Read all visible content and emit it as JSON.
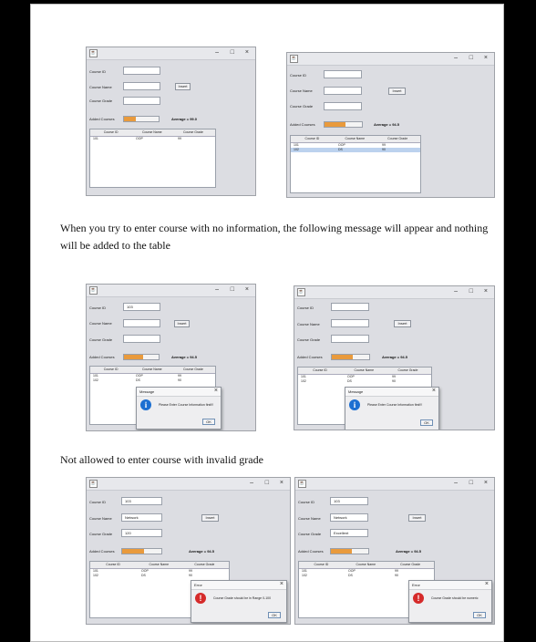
{
  "paragraphs": {
    "p1_line1": "When you try to enter course with no information, the following message will appear and nothing",
    "p1_line2": "will be added to the table",
    "p2": "Not allowed to enter course with invalid grade"
  },
  "screens": [
    {
      "labels": {
        "course_id": "Course ID",
        "course_name": "Course Name",
        "course_grade": "Course Grade",
        "added_courses": "Added Courses"
      },
      "values": {
        "course_id": "",
        "course_name": "",
        "course_grade": ""
      },
      "insert_label": "Insert",
      "progress": 0.35,
      "average": "Average = 99.0",
      "columns": [
        "Course ID",
        "Course Name",
        "Course Grade"
      ],
      "rows": [
        [
          "101",
          "OOP",
          "99"
        ]
      ]
    },
    {
      "labels": {
        "course_id": "Course ID",
        "course_name": "Course Name",
        "course_grade": "Course Grade",
        "added_courses": "Added Courses"
      },
      "values": {
        "course_id": "",
        "course_name": "",
        "course_grade": ""
      },
      "insert_label": "Insert",
      "progress": 0.55,
      "average": "Average = 94.5",
      "columns": [
        "Course ID",
        "Course Name",
        "Course Grade"
      ],
      "rows": [
        [
          "101",
          "OOP",
          "99"
        ],
        [
          "102",
          "DS",
          "90"
        ]
      ]
    },
    {
      "labels": {
        "course_id": "Course ID",
        "course_name": "Course Name",
        "course_grade": "Course Grade",
        "added_courses": "Added Courses"
      },
      "values": {
        "course_id": "103",
        "course_name": "",
        "course_grade": ""
      },
      "insert_label": "Insert",
      "progress": 0.55,
      "average": "Average = 94.5",
      "columns": [
        "Course ID",
        "Course Name",
        "Course Grade"
      ],
      "rows": [
        [
          "101",
          "OOP",
          "99"
        ],
        [
          "102",
          "DS",
          "90"
        ]
      ],
      "dialog": {
        "title": "Message",
        "message": "Please Enter Course Information first!!!",
        "ok": "OK",
        "icon": "info"
      }
    },
    {
      "labels": {
        "course_id": "Course ID",
        "course_name": "Course Name",
        "course_grade": "Course Grade",
        "added_courses": "Added Courses"
      },
      "values": {
        "course_id": "",
        "course_name": "",
        "course_grade": ""
      },
      "insert_label": "Insert",
      "progress": 0.55,
      "average": "Average = 94.5",
      "columns": [
        "Course ID",
        "Course Name",
        "Course Grade"
      ],
      "rows": [
        [
          "101",
          "OOP",
          "99"
        ],
        [
          "102",
          "DS",
          "90"
        ]
      ],
      "dialog": {
        "title": "Message",
        "message": "Please Enter Course Information first!!!",
        "ok": "OK",
        "icon": "info"
      }
    },
    {
      "labels": {
        "course_id": "Course ID",
        "course_name": "Course Name",
        "course_grade": "Course Grade",
        "added_courses": "Added Courses"
      },
      "values": {
        "course_id": "103",
        "course_name": "Network",
        "course_grade": "120"
      },
      "insert_label": "Insert",
      "progress": 0.55,
      "average": "Average = 94.5",
      "columns": [
        "Course ID",
        "Course Name",
        "Course Grade"
      ],
      "rows": [
        [
          "101",
          "OOP",
          "99"
        ],
        [
          "102",
          "DS",
          "90"
        ]
      ],
      "dialog": {
        "title": "Error",
        "message": "Course Grade should be in Range 0-100",
        "ok": "OK",
        "icon": "error"
      }
    },
    {
      "labels": {
        "course_id": "Course ID",
        "course_name": "Course Name",
        "course_grade": "Course Grade",
        "added_courses": "Added Courses"
      },
      "values": {
        "course_id": "103",
        "course_name": "Network",
        "course_grade": "Excellent"
      },
      "insert_label": "Insert",
      "progress": 0.55,
      "average": "Average = 94.5",
      "columns": [
        "Course ID",
        "Course Name",
        "Course Grade"
      ],
      "rows": [
        [
          "101",
          "OOP",
          "99"
        ],
        [
          "102",
          "DS",
          "90"
        ]
      ],
      "dialog": {
        "title": "Error",
        "message": "Course Grade should be numeric",
        "ok": "OK",
        "icon": "error"
      }
    }
  ]
}
